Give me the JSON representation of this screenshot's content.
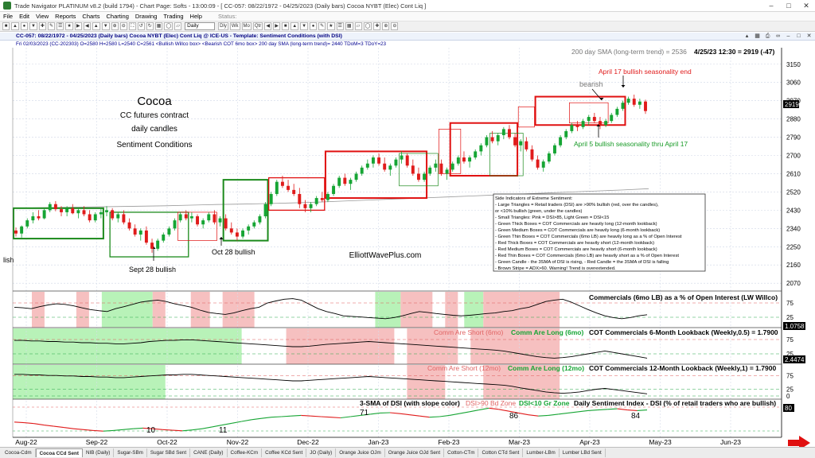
{
  "window": {
    "title": "Trade Navigator PLATINUM v8.2 (build 1794)   -   Chart Page: Softs   -   13:00:09   -   [ CC-057: 08/22/1972 - 04/25/2023 (Daily bars)  Cocoa NYBT (Elec) Cont Liq ]"
  },
  "menu": {
    "items": [
      "File",
      "Edit",
      "View",
      "Reports",
      "Charts",
      "Charting",
      "Drawing",
      "Trading",
      "Help"
    ],
    "status": "Status:"
  },
  "toolbar": {
    "period": "Daily",
    "buttons": [
      "Dly",
      "Wk",
      "Mo",
      "Qtr"
    ]
  },
  "chart_header": "CC-057: 08/22/1972 - 04/25/2023 (Daily bars)   Cocoa NYBT (Elec) Cont Liq @ ICE-US   -   Template: Sentiment Conditions (with DSI)",
  "chart_info": "Fri  02/03/2023 (CC-202303)  O=2580  H=2580  L=2540  C=2561  <Bullish Willco box>  <Bearish COT 6mo box>  200 day SMA (long-term trend)= 2440  TDoM=3  TDoY=23",
  "tabs": [
    "Cocoa-Cdm",
    "Cocoa CCd Sent",
    "NIB (Daily)",
    "Sugar-SBm",
    "Sugar SBd Sent",
    "CANE (Daily)",
    "Coffee-KCm",
    "Coffee KCd Sent",
    "JO (Daily)",
    "Orange Juice OJm",
    "Orange Juice OJd Sent",
    "Cotton-CTm",
    "Cotton CTd Sent",
    "Lumber-LBm",
    "Lumber LBd Sent"
  ],
  "active_tab": "Cocoa CCd Sent",
  "chart_data": {
    "type": "candlestick",
    "price_axis": [
      3150,
      3060,
      2970,
      2880,
      2790,
      2700,
      2610,
      2520,
      2430,
      2340,
      2250,
      2160,
      2070
    ],
    "ylim": [
      2055,
      3200
    ],
    "time_axis": [
      "Aug-22",
      "Sep-22",
      "Oct-22",
      "Nov-22",
      "Dec-22",
      "Jan-23",
      "Feb-23",
      "Mar-23",
      "Apr-23",
      "May-23",
      "Jun-23"
    ],
    "last_price_label": "2919",
    "header_sma": "200 day SMA (long-term trend) = 2536",
    "header_last": "4/25/23 12:30 = 2919 (-47)",
    "title_lines": [
      "Cocoa",
      "CC futures contract",
      "daily candles",
      "Sentiment Conditions"
    ],
    "watermark": "ElliottWavePlus.com",
    "annotations": {
      "sept28": "Sept 28 bullish",
      "oct28": "Oct 28 bullish",
      "bearish": "bearish",
      "april17": "April 17 bullish seasonality end",
      "april5": "April 5 bullish seasonality thru April 17",
      "lish": "lish"
    },
    "legend_lines": [
      "Side Indicators of Extreme Sentiment:",
      "- Large Triangles = Retail traders (DSI) are >90% bullish (red, over the candles),",
      "  or <10% bullish (green, under the candles)",
      "- Small Triangles: Pink = DSI>85, Light Green = DSI<15",
      "- Green Thick Boxes = COT Commercials are heavily long (12-month lookback)",
      "- Green Medium Boxes = COT Commercials are heavily long (6-month lookback)",
      "- Green Thin Boxes = COT Commercials (6mo LB) are heavily long as a % of Open Interest",
      "- Red Thick Boxes = COT Commercials are heavily short (12-month lookback)",
      "- Red Medium Boxes = COT Commercials are heavily short (6-month lookback)",
      "- Red Thin Boxes = COT Commercials (6mo LB) are heavily short as a % of Open Interest",
      "- Green Candle - the 3SMA of DSI is rising,  - Red Candle = the 3SMA of DSI is falling",
      "- Brown Stripe = ADX>60. Warning! Trend is overextended."
    ],
    "candles": [
      [
        2330,
        2345,
        2300,
        2315
      ],
      [
        2315,
        2355,
        2295,
        2350
      ],
      [
        2350,
        2390,
        2340,
        2380
      ],
      [
        2380,
        2420,
        2365,
        2400
      ],
      [
        2400,
        2430,
        2380,
        2390
      ],
      [
        2390,
        2440,
        2385,
        2430
      ],
      [
        2430,
        2470,
        2420,
        2460
      ],
      [
        2460,
        2475,
        2425,
        2435
      ],
      [
        2435,
        2450,
        2400,
        2420
      ],
      [
        2420,
        2450,
        2400,
        2440
      ],
      [
        2440,
        2460,
        2410,
        2415
      ],
      [
        2415,
        2440,
        2390,
        2430
      ],
      [
        2430,
        2450,
        2400,
        2410
      ],
      [
        2410,
        2430,
        2370,
        2380
      ],
      [
        2380,
        2420,
        2370,
        2410
      ],
      [
        2410,
        2440,
        2390,
        2420
      ],
      [
        2420,
        2450,
        2400,
        2430
      ],
      [
        2430,
        2440,
        2380,
        2390
      ],
      [
        2390,
        2420,
        2370,
        2410
      ],
      [
        2410,
        2430,
        2360,
        2370
      ],
      [
        2370,
        2390,
        2330,
        2340
      ],
      [
        2340,
        2360,
        2300,
        2310
      ],
      [
        2310,
        2340,
        2280,
        2330
      ],
      [
        2330,
        2350,
        2260,
        2270
      ],
      [
        2270,
        2290,
        2220,
        2240
      ],
      [
        2240,
        2290,
        2230,
        2280
      ],
      [
        2280,
        2320,
        2270,
        2310
      ],
      [
        2310,
        2350,
        2300,
        2340
      ],
      [
        2340,
        2390,
        2330,
        2380
      ],
      [
        2380,
        2420,
        2370,
        2410
      ],
      [
        2410,
        2430,
        2380,
        2390
      ],
      [
        2390,
        2420,
        2370,
        2400
      ],
      [
        2400,
        2410,
        2350,
        2360
      ],
      [
        2360,
        2390,
        2340,
        2380
      ],
      [
        2380,
        2420,
        2370,
        2410
      ],
      [
        2410,
        2430,
        2360,
        2370
      ],
      [
        2370,
        2400,
        2350,
        2390
      ],
      [
        2390,
        2410,
        2330,
        2340
      ],
      [
        2340,
        2370,
        2310,
        2320
      ],
      [
        2320,
        2340,
        2280,
        2300
      ],
      [
        2300,
        2340,
        2290,
        2330
      ],
      [
        2330,
        2360,
        2310,
        2350
      ],
      [
        2350,
        2380,
        2340,
        2370
      ],
      [
        2370,
        2410,
        2360,
        2400
      ],
      [
        2400,
        2470,
        2390,
        2460
      ],
      [
        2460,
        2520,
        2450,
        2510
      ],
      [
        2510,
        2580,
        2500,
        2570
      ],
      [
        2570,
        2600,
        2540,
        2550
      ],
      [
        2550,
        2580,
        2520,
        2530
      ],
      [
        2530,
        2560,
        2500,
        2510
      ],
      [
        2510,
        2540,
        2440,
        2460
      ],
      [
        2460,
        2480,
        2420,
        2440
      ],
      [
        2440,
        2470,
        2420,
        2460
      ],
      [
        2460,
        2500,
        2450,
        2490
      ],
      [
        2490,
        2520,
        2470,
        2480
      ],
      [
        2480,
        2520,
        2470,
        2510
      ],
      [
        2510,
        2560,
        2500,
        2550
      ],
      [
        2550,
        2600,
        2540,
        2590
      ],
      [
        2590,
        2610,
        2550,
        2560
      ],
      [
        2560,
        2590,
        2530,
        2580
      ],
      [
        2580,
        2620,
        2570,
        2610
      ],
      [
        2610,
        2650,
        2600,
        2640
      ],
      [
        2640,
        2680,
        2630,
        2660
      ],
      [
        2660,
        2700,
        2640,
        2690
      ],
      [
        2690,
        2710,
        2650,
        2660
      ],
      [
        2660,
        2690,
        2620,
        2630
      ],
      [
        2630,
        2660,
        2600,
        2650
      ],
      [
        2650,
        2690,
        2640,
        2680
      ],
      [
        2680,
        2720,
        2660,
        2700
      ],
      [
        2700,
        2710,
        2640,
        2650
      ],
      [
        2650,
        2680,
        2600,
        2610
      ],
      [
        2610,
        2640,
        2570,
        2580
      ],
      [
        2580,
        2620,
        2570,
        2610
      ],
      [
        2610,
        2650,
        2600,
        2640
      ],
      [
        2640,
        2680,
        2620,
        2660
      ],
      [
        2660,
        2680,
        2600,
        2610
      ],
      [
        2610,
        2640,
        2580,
        2630
      ],
      [
        2630,
        2670,
        2620,
        2660
      ],
      [
        2660,
        2700,
        2650,
        2690
      ],
      [
        2690,
        2720,
        2660,
        2670
      ],
      [
        2670,
        2700,
        2640,
        2690
      ],
      [
        2690,
        2730,
        2680,
        2720
      ],
      [
        2720,
        2760,
        2700,
        2750
      ],
      [
        2750,
        2800,
        2740,
        2790
      ],
      [
        2790,
        2820,
        2760,
        2770
      ],
      [
        2770,
        2810,
        2750,
        2800
      ],
      [
        2800,
        2840,
        2780,
        2830
      ],
      [
        2830,
        2850,
        2780,
        2790
      ],
      [
        2790,
        2810,
        2740,
        2750
      ],
      [
        2750,
        2780,
        2720,
        2770
      ],
      [
        2770,
        2790,
        2720,
        2730
      ],
      [
        2730,
        2750,
        2670,
        2680
      ],
      [
        2680,
        2700,
        2630,
        2640
      ],
      [
        2640,
        2680,
        2620,
        2670
      ],
      [
        2670,
        2720,
        2660,
        2710
      ],
      [
        2710,
        2760,
        2700,
        2750
      ],
      [
        2750,
        2800,
        2740,
        2790
      ],
      [
        2790,
        2830,
        2780,
        2820
      ],
      [
        2820,
        2860,
        2810,
        2850
      ],
      [
        2850,
        2870,
        2820,
        2840
      ],
      [
        2840,
        2880,
        2830,
        2870
      ],
      [
        2870,
        2900,
        2850,
        2890
      ],
      [
        2890,
        2910,
        2860,
        2870
      ],
      [
        2870,
        2890,
        2830,
        2850
      ],
      [
        2850,
        2880,
        2840,
        2870
      ],
      [
        2870,
        2910,
        2860,
        2900
      ],
      [
        2900,
        2940,
        2890,
        2930
      ],
      [
        2930,
        2970,
        2920,
        2960
      ],
      [
        2960,
        2990,
        2950,
        2980
      ],
      [
        2980,
        3000,
        2940,
        2950
      ],
      [
        2950,
        2980,
        2930,
        2966
      ],
      [
        2966,
        2975,
        2905,
        2919
      ]
    ],
    "sma200": [
      2440,
      2442,
      2444,
      2446,
      2448,
      2450,
      2452,
      2455,
      2458,
      2460,
      2463,
      2466,
      2470,
      2475,
      2480,
      2485,
      2490,
      2495,
      2500,
      2505,
      2510,
      2515,
      2520,
      2525,
      2530,
      2536
    ],
    "boxes": [
      {
        "color": "green",
        "weight": "thick",
        "t0": 0,
        "t1": 15,
        "p0": 2290,
        "p1": 2440
      },
      {
        "color": "green",
        "weight": "medium",
        "t0": 17,
        "t1": 30,
        "p0": 2200,
        "p1": 2420
      },
      {
        "color": "red",
        "weight": "thin",
        "t0": 29,
        "t1": 35,
        "p0": 2280,
        "p1": 2420
      },
      {
        "color": "green",
        "weight": "thick",
        "t0": 37,
        "t1": 44,
        "p0": 2280,
        "p1": 2580
      },
      {
        "color": "red",
        "weight": "medium",
        "t0": 45,
        "t1": 54,
        "p0": 2430,
        "p1": 2590
      },
      {
        "color": "red",
        "weight": "thick",
        "t0": 55,
        "t1": 72,
        "p0": 2490,
        "p1": 2720
      },
      {
        "color": "green",
        "weight": "thin",
        "t0": 68,
        "t1": 74,
        "p0": 2550,
        "p1": 2710
      },
      {
        "color": "red",
        "weight": "thin",
        "t0": 75,
        "t1": 78,
        "p0": 2610,
        "p1": 2830
      },
      {
        "color": "red",
        "weight": "thick",
        "t0": 77,
        "t1": 88,
        "p0": 2600,
        "p1": 2860
      },
      {
        "color": "green",
        "weight": "thin",
        "t0": 84,
        "t1": 89,
        "p0": 2600,
        "p1": 2810
      },
      {
        "color": "red",
        "weight": "thin",
        "t0": 89,
        "t1": 91,
        "p0": 2840,
        "p1": 2940
      },
      {
        "color": "red",
        "weight": "thick",
        "t0": 92,
        "t1": 107,
        "p0": 2850,
        "p1": 2990
      },
      {
        "color": "red",
        "weight": "thin",
        "t0": 98,
        "t1": 104,
        "p0": 2860,
        "p1": 2960
      }
    ],
    "panel1": {
      "title": "Commercials (6mo LB) as a % of Open Interest (LW Willco)",
      "ticks": [
        "75",
        "25"
      ],
      "right_value": "1.0758",
      "line": [
        60,
        58,
        55,
        62,
        68,
        72,
        70,
        65,
        58,
        52,
        48,
        45,
        55,
        62,
        70,
        78,
        82,
        85,
        80,
        72,
        66,
        60,
        50,
        42,
        38,
        35,
        40,
        48,
        55,
        60,
        75,
        82,
        88,
        90,
        85,
        70,
        55,
        45,
        38,
        30,
        28,
        26,
        24,
        22,
        20,
        24,
        30,
        38,
        45,
        42,
        38,
        35,
        32,
        30,
        32,
        35,
        38,
        40,
        45,
        48,
        55,
        60,
        70,
        80,
        85,
        88,
        78,
        65,
        52,
        40,
        30,
        24,
        20,
        24,
        30,
        34
      ],
      "bands": [
        {
          "color": "red",
          "t0": 0.03,
          "t1": 0.05
        },
        {
          "color": "red",
          "t0": 0.1,
          "t1": 0.12
        },
        {
          "color": "green",
          "t0": 0.14,
          "t1": 0.22
        },
        {
          "color": "red",
          "t0": 0.22,
          "t1": 0.24
        },
        {
          "color": "red",
          "t0": 0.28,
          "t1": 0.31
        },
        {
          "color": "red",
          "t0": 0.33,
          "t1": 0.38
        },
        {
          "color": "green",
          "t0": 0.57,
          "t1": 0.61
        },
        {
          "color": "red",
          "t0": 0.61,
          "t1": 0.66
        },
        {
          "color": "red",
          "t0": 0.68,
          "t1": 0.7
        },
        {
          "color": "green",
          "t0": 0.71,
          "t1": 0.74
        },
        {
          "color": "red",
          "t0": 0.74,
          "t1": 0.86
        }
      ]
    },
    "panel2": {
      "title": "COT Commercials 6-Month Lookback (Weekly,0.5) = 1.7900",
      "label_short": "Comm Are Short (6mo)",
      "label_long": "Comm Are Long (6mo)",
      "ticks": [
        "75",
        "25"
      ],
      "right_value": "2.4474",
      "line": [
        72,
        72,
        70,
        70,
        68,
        68,
        66,
        66,
        64,
        64,
        62,
        62,
        60,
        60,
        62,
        64,
        68,
        70,
        72,
        72,
        74,
        74,
        72,
        70,
        68,
        66,
        64,
        62,
        60,
        58,
        56,
        54,
        52,
        50,
        50,
        52,
        55,
        58,
        60,
        62,
        64,
        66,
        68,
        66,
        64,
        62,
        60,
        58,
        56,
        54,
        52,
        50,
        48,
        46,
        44,
        42,
        40,
        38,
        35,
        30,
        25,
        20,
        15,
        12,
        10,
        12,
        15,
        20,
        25,
        30,
        35,
        30,
        25,
        20,
        15,
        10
      ],
      "bands": [
        {
          "color": "green",
          "t0": 0.0,
          "t1": 0.36
        },
        {
          "color": "red",
          "t0": 0.43,
          "t1": 0.6
        },
        {
          "color": "red",
          "t0": 0.62,
          "t1": 0.7
        },
        {
          "color": "red",
          "t0": 0.72,
          "t1": 0.86
        }
      ]
    },
    "panel3": {
      "title": "COT Commercials 12-Month Lookback (Weekly,1) = 1.7900",
      "label_short": "Comm Are Short (12mo)",
      "label_long": "Comm Are Long (12mo)",
      "ticks": [
        "75",
        "25",
        "0"
      ],
      "right_value": "",
      "line": [
        80,
        80,
        78,
        78,
        76,
        76,
        74,
        74,
        72,
        72,
        70,
        70,
        68,
        68,
        70,
        72,
        74,
        76,
        78,
        78,
        80,
        80,
        78,
        76,
        74,
        72,
        70,
        68,
        66,
        64,
        62,
        60,
        58,
        56,
        56,
        58,
        60,
        62,
        64,
        66,
        68,
        70,
        72,
        70,
        68,
        66,
        64,
        62,
        60,
        58,
        56,
        54,
        52,
        50,
        48,
        46,
        44,
        42,
        40,
        36,
        30,
        25,
        20,
        15,
        12,
        10,
        12,
        15,
        20,
        25,
        28,
        24,
        20,
        16,
        12,
        8
      ],
      "bands": [
        {
          "color": "green",
          "t0": 0.0,
          "t1": 0.24
        },
        {
          "color": "red",
          "t0": 0.62,
          "t1": 0.68
        },
        {
          "color": "red",
          "t0": 0.74,
          "t1": 0.86
        }
      ]
    },
    "panel4": {
      "title": "Daily Sentiment Index - DSI (% of retail traders who are bullish)",
      "legend_sma": "3-SMA of DSI (with slope color)",
      "legend_bd": "DSI>90 Bd Zone",
      "legend_gr": "DSI<10 Gr Zone",
      "right_value": "80",
      "labels": {
        "l10": "10",
        "l11": "11",
        "l71": "71",
        "l86": "86",
        "l84": "84"
      },
      "line": [
        40,
        38,
        35,
        30,
        26,
        22,
        18,
        15,
        12,
        10,
        12,
        15,
        18,
        20,
        18,
        15,
        13,
        11,
        14,
        18,
        24,
        30,
        36,
        42,
        48,
        52,
        56,
        58,
        60,
        62,
        60,
        58,
        56,
        54,
        58,
        62,
        66,
        70,
        71,
        68,
        64,
        60,
        56,
        58,
        62,
        68,
        74,
        80,
        86,
        82,
        76,
        70,
        64,
        60,
        62,
        66,
        70,
        74,
        78,
        80,
        82,
        84,
        80,
        78,
        80
      ]
    }
  }
}
